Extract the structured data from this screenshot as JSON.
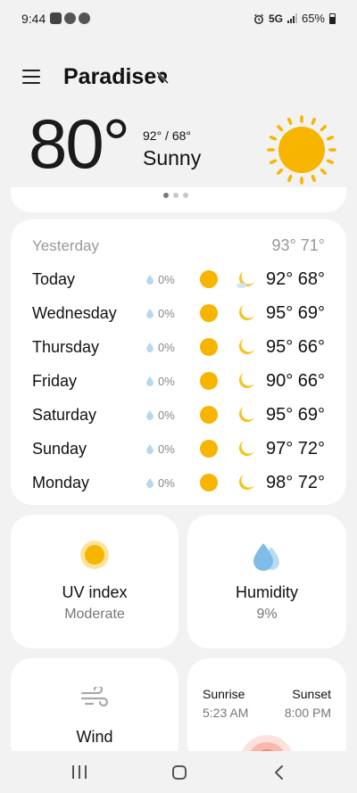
{
  "status_bar": {
    "time": "9:44",
    "network": "5G",
    "battery": "65%"
  },
  "header": {
    "city": "Paradise",
    "location_icon": "location-off-icon"
  },
  "current": {
    "temp": "80°",
    "hilo": "92° / 68°",
    "condition": "Sunny",
    "icon": "sun-icon"
  },
  "daily": {
    "yesterday_label": "Yesterday",
    "yesterday_temps": "93° 71°",
    "rows": [
      {
        "day": "Today",
        "precip": "0%",
        "temps": "92° 68°"
      },
      {
        "day": "Wednesday",
        "precip": "0%",
        "temps": "95° 69°"
      },
      {
        "day": "Thursday",
        "precip": "0%",
        "temps": "95° 66°"
      },
      {
        "day": "Friday",
        "precip": "0%",
        "temps": "90° 66°"
      },
      {
        "day": "Saturday",
        "precip": "0%",
        "temps": "95° 69°"
      },
      {
        "day": "Sunday",
        "precip": "0%",
        "temps": "97° 72°"
      },
      {
        "day": "Monday",
        "precip": "0%",
        "temps": "98° 72°"
      }
    ]
  },
  "tiles": {
    "uv": {
      "title": "UV index",
      "value": "Moderate"
    },
    "humidity": {
      "title": "Humidity",
      "value": "9%"
    },
    "wind": {
      "title": "Wind"
    },
    "sun": {
      "sunrise_label": "Sunrise",
      "sunrise_time": "5:23 AM",
      "sunset_label": "Sunset",
      "sunset_time": "8:00 PM"
    }
  },
  "colors": {
    "sun": "#f7b500",
    "sun_light": "#ffd54a",
    "drop": "#b8d8f0",
    "humidity": "#7fbce8",
    "background": "#f2f2f2",
    "card": "#ffffff"
  }
}
